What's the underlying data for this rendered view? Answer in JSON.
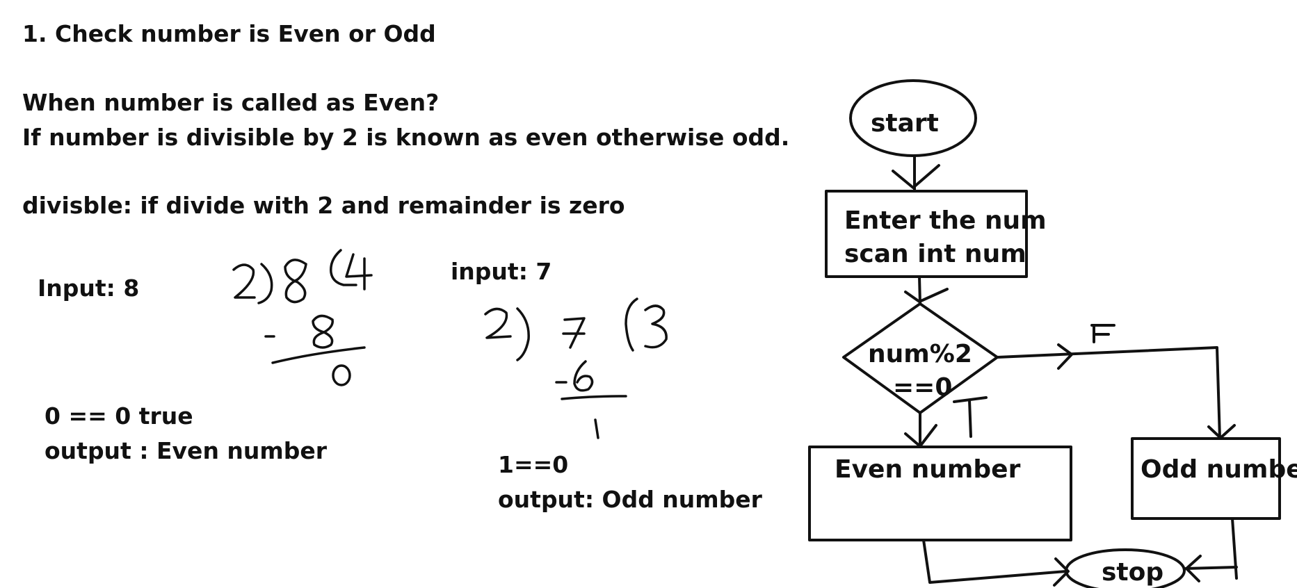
{
  "notes": {
    "heading": "1. Check number is Even or Odd",
    "question": "When number is called as Even?",
    "definition": "If number is divisible by 2 is known as even otherwise odd.",
    "divisible_note": "divisble: if divide with  2 and remainder is zero"
  },
  "example_even": {
    "input_label": "Input:  8",
    "division": {
      "divisor": "2",
      "dividend": "8",
      "quotient": "4",
      "subtracted": "- 8",
      "remainder": "0"
    },
    "check": "0 == 0 true",
    "output": "output : Even number"
  },
  "example_odd": {
    "input_label": "input: 7",
    "division": {
      "divisor": "2",
      "dividend": "7",
      "quotient": "3",
      "subtracted": "-6",
      "remainder": "1"
    },
    "check": "1==0",
    "output": "output: Odd number"
  },
  "flowchart": {
    "start": "start",
    "input_line1": "Enter the num",
    "input_line2": "scan int num",
    "decision_line1": "num%2",
    "decision_line2": "==0",
    "false_label": "F",
    "true_label": "T",
    "even": "Even number",
    "odd": "Odd number",
    "stop": "stop"
  }
}
